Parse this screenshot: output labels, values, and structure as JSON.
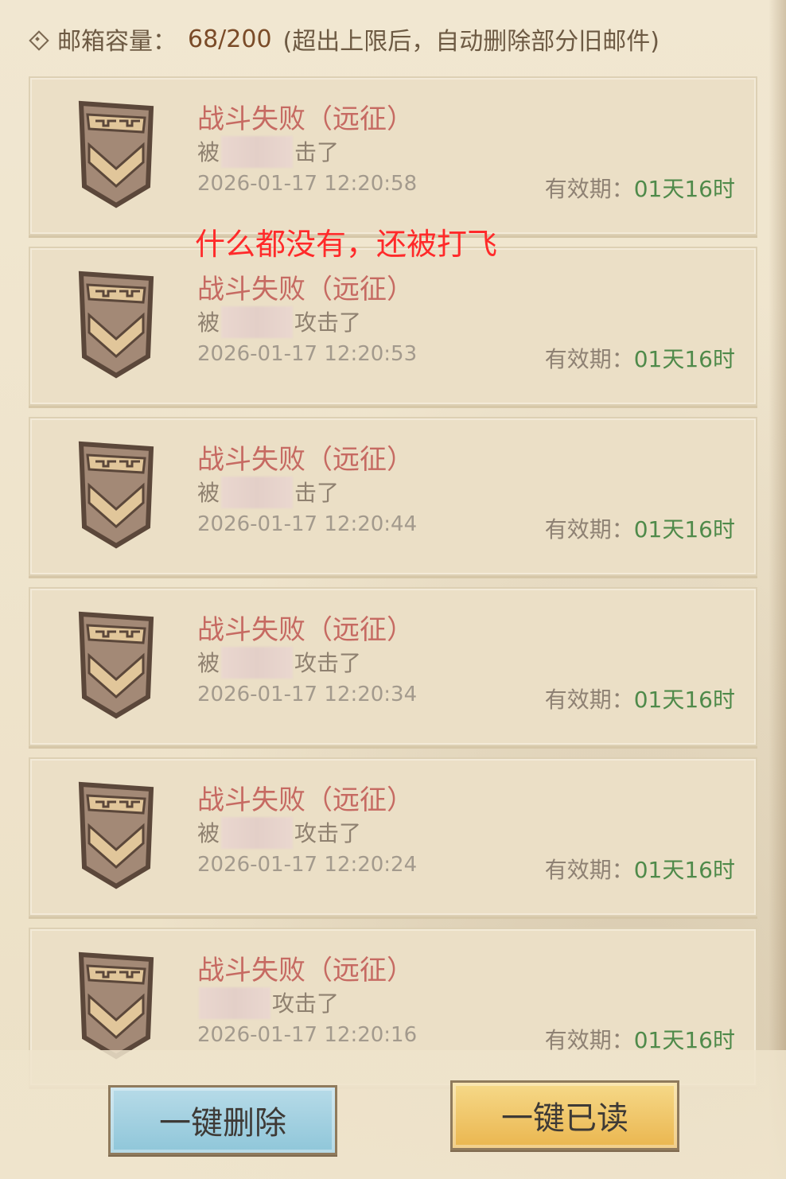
{
  "header": {
    "label": "邮箱容量：",
    "value": "68/200",
    "note": "(超出上限后，自动删除部分旧邮件)"
  },
  "annotation": "什么都没有，还被打飞",
  "mails": [
    {
      "title": "战斗失败（远征）",
      "body_prefix": "被",
      "body_suffix": "击了",
      "time": "2026-01-17 12:20:58",
      "expiry_label": "有效期：",
      "expiry_value": "01天16时"
    },
    {
      "title": "战斗失败（远征）",
      "body_prefix": "被",
      "body_suffix": "攻击了",
      "time": "2026-01-17 12:20:53",
      "expiry_label": "有效期：",
      "expiry_value": "01天16时"
    },
    {
      "title": "战斗失败（远征）",
      "body_prefix": "被",
      "body_suffix": "击了",
      "time": "2026-01-17 12:20:44",
      "expiry_label": "有效期：",
      "expiry_value": "01天16时"
    },
    {
      "title": "战斗失败（远征）",
      "body_prefix": "被",
      "body_suffix": "攻击了",
      "time": "2026-01-17 12:20:34",
      "expiry_label": "有效期：",
      "expiry_value": "01天16时"
    },
    {
      "title": "战斗失败（远征）",
      "body_prefix": "被",
      "body_suffix": "攻击了",
      "time": "2026-01-17 12:20:24",
      "expiry_label": "有效期：",
      "expiry_value": "01天16时"
    },
    {
      "title": "战斗失败（远征）",
      "body_prefix": "",
      "body_suffix": "攻击了",
      "time": "2026-01-17 12:20:16",
      "expiry_label": "有效期：",
      "expiry_value": "01天16时"
    }
  ],
  "buttons": {
    "delete_all": "一键删除",
    "read_all": "一键已读"
  },
  "colors": {
    "title_red": "#c66a62",
    "expiry_green": "#4f8a4a",
    "delete_btn": "#9fd0e0",
    "read_btn": "#efc45f"
  }
}
